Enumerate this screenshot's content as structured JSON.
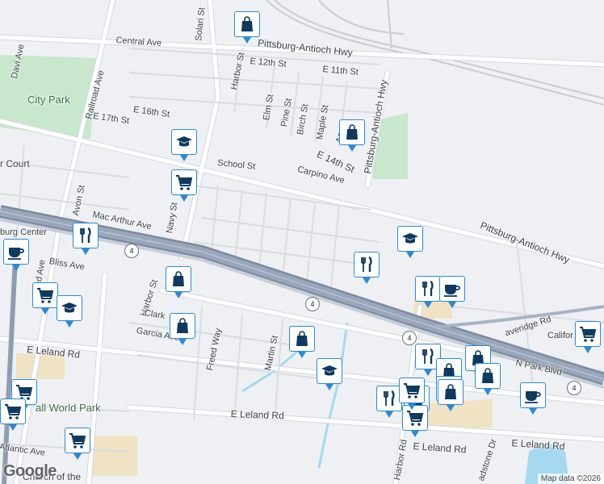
{
  "map": {
    "attribution": "Map data ©2026",
    "logo": "Google",
    "colors": {
      "land": "#eef0f3",
      "street": "#ffffff",
      "street_outline": "#d4d8de",
      "freeway": "#8f9db3",
      "park": "#c9e7cd",
      "water": "#a5d9f0",
      "rail": "#c9ccd1",
      "pin_border": "#2d89d6",
      "pin_icon": "#0e3a5f",
      "sand": "#efe3c4"
    },
    "places": {
      "city_park": "City Park",
      "small_world_park": "all World Park",
      "court": "r Court",
      "center": "burg Center",
      "church": "Church of the"
    },
    "streets": {
      "solari": "Solari St",
      "harbor_n": "Harbor St",
      "harbor_s": "Harbor St",
      "central": "Central Ave",
      "pa_hwy_n": "Pittsburg-Antioch Hwy",
      "pa_hwy_v": "Pittsburg-Antioch Hwy",
      "pa_hwy_e": "Pittsburg-Antioch Hwy",
      "e12": "E 12th St",
      "e11": "E 11th St",
      "railroad": "Railroad Ave",
      "davi": "Davi Ave",
      "e16": "E 16th St",
      "e17": "E 17th St",
      "elm": "Elm St",
      "pine": "Pine St",
      "birch": "Birch St",
      "maple": "Maple St",
      "ac": "Ac",
      "e14": "E 14th St",
      "school": "School St",
      "carpino": "Carpino Ave",
      "avon": "Avon St",
      "macarthur": "Mac Arthur Ave",
      "navy": "Navy St",
      "bliss": "Bliss Ave",
      "clark": "Clark",
      "garcia": "Garcia Ave",
      "freedway": "Freed Way",
      "martin": "Martin St",
      "eleland_w": "E Leland Rd",
      "eleland_c": "E Leland Rd",
      "eleland_e": "E Leland Rd",
      "eleland_f": "E Leland Rd",
      "atlantic": "Atlantic Ave",
      "leaveridge": "averidge Rd",
      "california": "Califor",
      "nparkblvd": "N Park Blvd",
      "harbor_rd": "Harbor Rd",
      "ladstone": "adstone Dr",
      "road_ave": "oad Ave"
    },
    "highways": [
      "4",
      "4",
      "4",
      "4"
    ],
    "pins": [
      {
        "type": "shopping-bag-icon",
        "label": "shopping"
      },
      {
        "type": "graduation-cap-icon",
        "label": "school"
      },
      {
        "type": "shopping-cart-icon",
        "label": "grocery"
      },
      {
        "type": "shopping-bag-icon",
        "label": "shopping"
      },
      {
        "type": "fork-knife-icon",
        "label": "restaurant"
      },
      {
        "type": "coffee-cup-icon",
        "label": "cafe"
      },
      {
        "type": "shopping-cart-icon",
        "label": "grocery"
      },
      {
        "type": "graduation-cap-icon",
        "label": "school"
      },
      {
        "type": "shopping-bag-icon",
        "label": "shopping"
      },
      {
        "type": "shopping-bag-icon",
        "label": "shopping"
      },
      {
        "type": "shopping-bag-icon",
        "label": "shopping"
      },
      {
        "type": "graduation-cap-icon",
        "label": "school"
      },
      {
        "type": "graduation-cap-icon",
        "label": "school"
      },
      {
        "type": "fork-knife-icon",
        "label": "restaurant"
      },
      {
        "type": "fork-knife-icon",
        "label": "restaurant"
      },
      {
        "type": "coffee-cup-icon",
        "label": "cafe"
      },
      {
        "type": "fork-knife-icon",
        "label": "restaurant"
      },
      {
        "type": "shopping-bag-icon",
        "label": "shopping"
      },
      {
        "type": "shopping-bag-icon",
        "label": "shopping"
      },
      {
        "type": "shopping-bag-icon",
        "label": "shopping"
      },
      {
        "type": "fork-knife-icon",
        "label": "restaurant"
      },
      {
        "type": "shopping-bag-icon",
        "label": "shopping"
      },
      {
        "type": "shopping-cart-icon",
        "label": "grocery"
      },
      {
        "type": "coffee-cup-icon",
        "label": "cafe"
      },
      {
        "type": "shopping-cart-icon",
        "label": "grocery"
      },
      {
        "type": "shopping-cart-icon",
        "label": "grocery"
      },
      {
        "type": "shopping-cart-icon",
        "label": "grocery"
      },
      {
        "type": "shopping-cart-icon",
        "label": "grocery"
      },
      {
        "type": "shopping-cart-icon",
        "label": "grocery"
      },
      {
        "type": "shopping-cart-icon",
        "label": "grocery"
      },
      {
        "type": "shopping-bag-icon",
        "label": "shopping"
      }
    ]
  }
}
